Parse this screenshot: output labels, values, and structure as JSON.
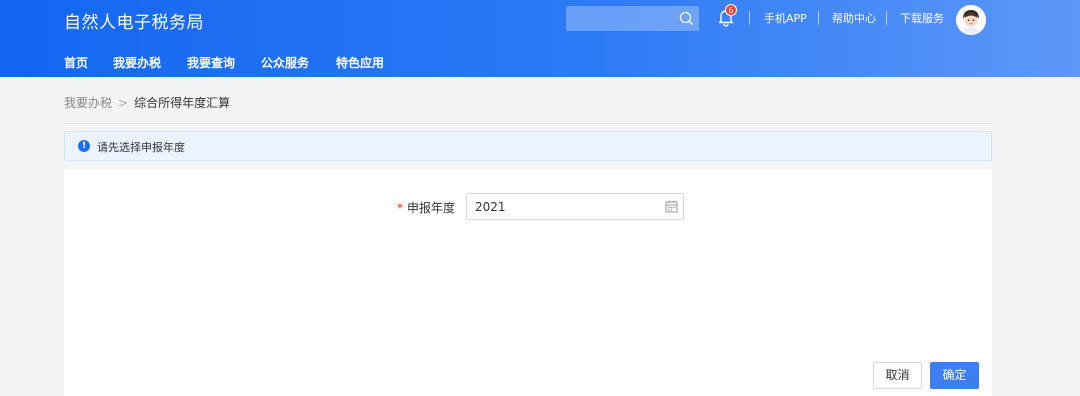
{
  "header": {
    "logo": "自然人电子税务局",
    "search": {
      "placeholder": ""
    },
    "notifications": {
      "count": "6"
    },
    "links": [
      "手机APP",
      "帮助中心",
      "下载服务"
    ]
  },
  "nav": [
    "首页",
    "我要办税",
    "我要查询",
    "公众服务",
    "特色应用"
  ],
  "breadcrumb": {
    "parent": "我要办税",
    "separator": ">",
    "current": "综合所得年度汇算"
  },
  "notice": {
    "text": "请先选择申报年度"
  },
  "form": {
    "required_mark": "*",
    "label": "申报年度",
    "year_value": "2021"
  },
  "actions": {
    "cancel": "取消",
    "confirm": "确定"
  },
  "colors": {
    "header_start": "#1366f0",
    "header_end": "#5d98f8",
    "primary": "#3d7ff2",
    "badge": "#ff3b30",
    "required": "#f5222d"
  }
}
